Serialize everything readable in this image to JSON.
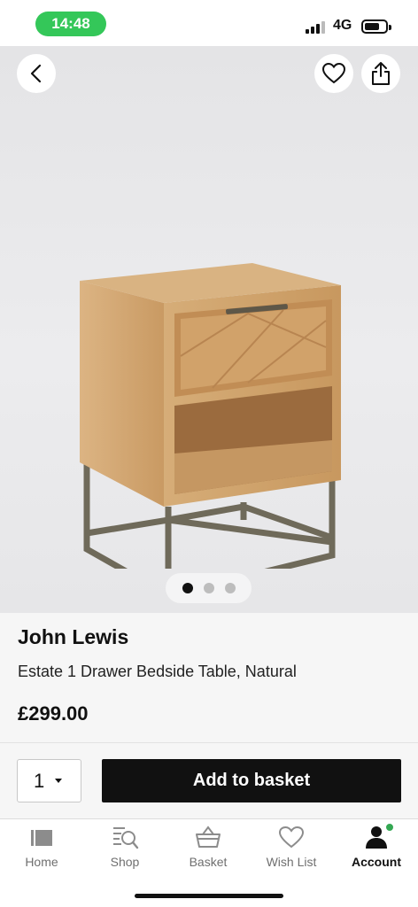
{
  "status_bar": {
    "time": "14:48",
    "network": "4G"
  },
  "product": {
    "brand": "John Lewis",
    "name": "Estate 1 Drawer Bedside Table, Natural",
    "price": "£299.00",
    "image_count": 3,
    "active_image_index": 0
  },
  "purchase": {
    "quantity": "1",
    "add_label": "Add to basket"
  },
  "tabs": [
    {
      "label": "Home",
      "icon": "home-icon"
    },
    {
      "label": "Shop",
      "icon": "shop-search-icon"
    },
    {
      "label": "Basket",
      "icon": "basket-icon"
    },
    {
      "label": "Wish List",
      "icon": "heart-icon"
    },
    {
      "label": "Account",
      "icon": "account-icon",
      "active": true
    }
  ],
  "colors": {
    "status_green": "#34c759",
    "button_black": "#111111",
    "account_badge": "#34a853"
  }
}
